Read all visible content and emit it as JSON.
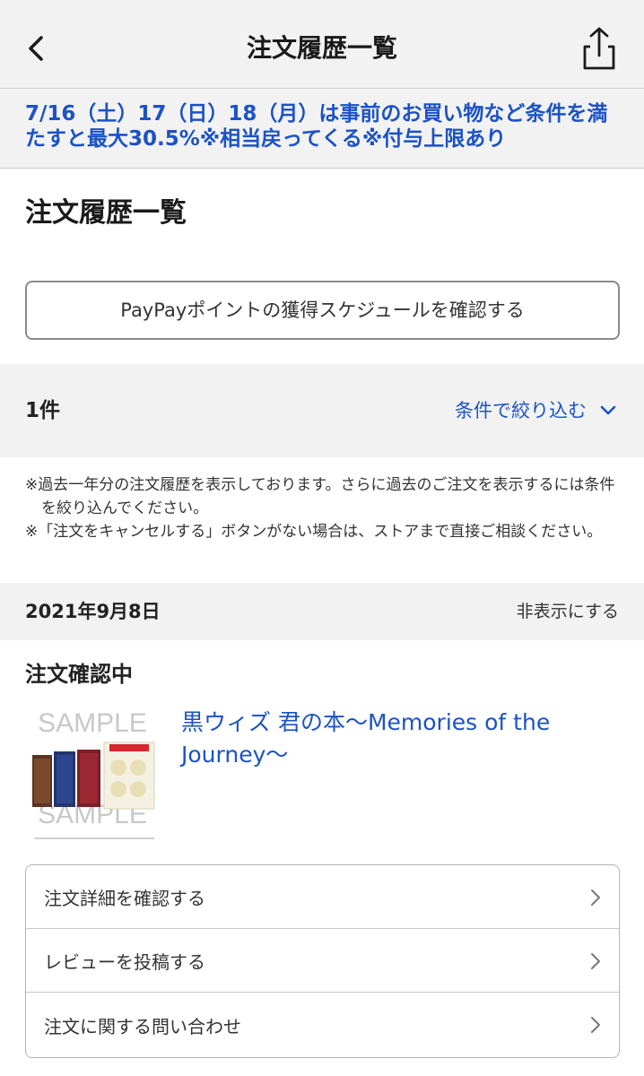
{
  "header": {
    "title": "注文履歴一覧",
    "back_icon": "chevron-left-icon",
    "share_icon": "share-icon"
  },
  "promo": {
    "text": "7/16（土）17（日）18（月）は事前のお買い物など条件を満たすと最大30.5%※相当戻ってくる※付与上限あり"
  },
  "page": {
    "title": "注文履歴一覧",
    "paypay_button": "PayPayポイントの獲得スケジュールを確認する"
  },
  "filter": {
    "count": "1件",
    "label": "条件で絞り込む"
  },
  "notes": [
    "※過去一年分の注文履歴を表示しております。さらに過去のご注文を表示するには条件を絞り込んでください。",
    "※「注文をキャンセルする」ボタンがない場合は、ストアまで直接ご相談ください。"
  ],
  "order": {
    "date": "2021年9月8日",
    "hide_label": "非表示にする",
    "status": "注文確認中",
    "product_title": "黒ウィズ 君の本〜Memories of the Journey〜",
    "thumbnail_watermark": "SAMPLE",
    "actions": [
      {
        "label": "注文詳細を確認する"
      },
      {
        "label": "レビューを投稿する"
      },
      {
        "label": "注文に関する問い合わせ"
      }
    ]
  },
  "colors": {
    "accent": "#1b52c6",
    "background_gray": "#f2f2f2"
  }
}
